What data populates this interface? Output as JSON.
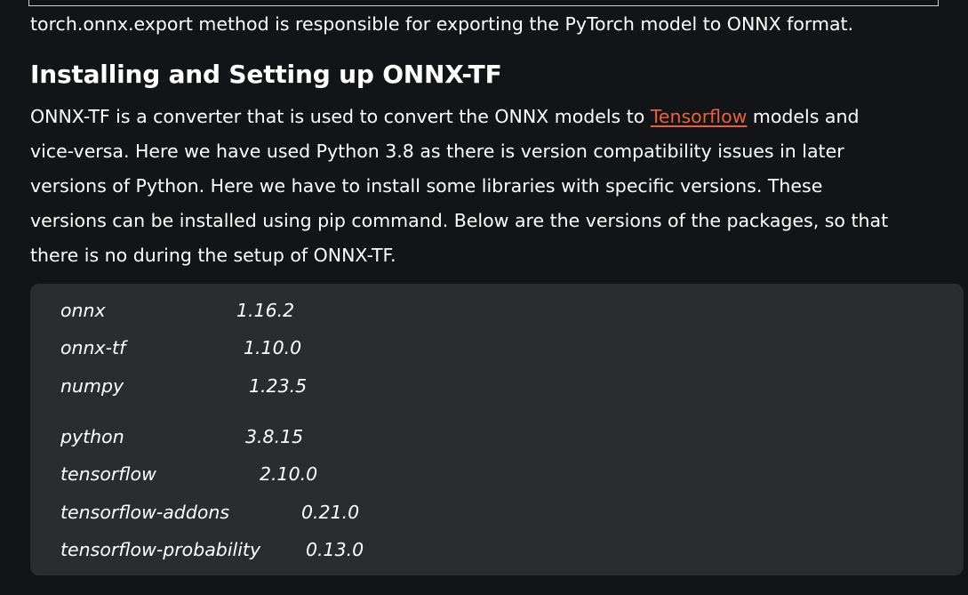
{
  "intro": {
    "text": "torch.onnx.export method is responsible for exporting the PyTorch model to ONNX format."
  },
  "section": {
    "heading": "Installing and Setting up ONNX-TF",
    "para": {
      "line1_before": "ONNX-TF is a converter that is used to convert the ONNX models to ",
      "link_text": "Tensorflow",
      "line1_after": " models and",
      "line2": "vice-versa. Here we have used Python 3.8 as there is version compatibility issues in later",
      "line3": "versions of Python. Here we have to install some libraries with specific versions. These",
      "line4": "versions can be installed using pip command. Below are the versions of the packages, so that",
      "line5": "there is no during the setup of ONNX-TF."
    }
  },
  "packages": [
    {
      "name": "onnx",
      "version": "1.16.2"
    },
    {
      "name": "onnx-tf",
      "version": "1.10.0"
    },
    {
      "name": "numpy",
      "version": "1.23.5"
    },
    {
      "name": "python",
      "version": "3.8.15"
    },
    {
      "name": "tensorflow",
      "version": "2.10.0"
    },
    {
      "name": "tensorflow-addons",
      "version": "0.21.0"
    },
    {
      "name": "tensorflow-probability",
      "version": "0.13.0"
    }
  ],
  "colors": {
    "background": "#131417",
    "panel": "#2b2c2f",
    "link": "#e9603d",
    "text": "#ffffff"
  }
}
